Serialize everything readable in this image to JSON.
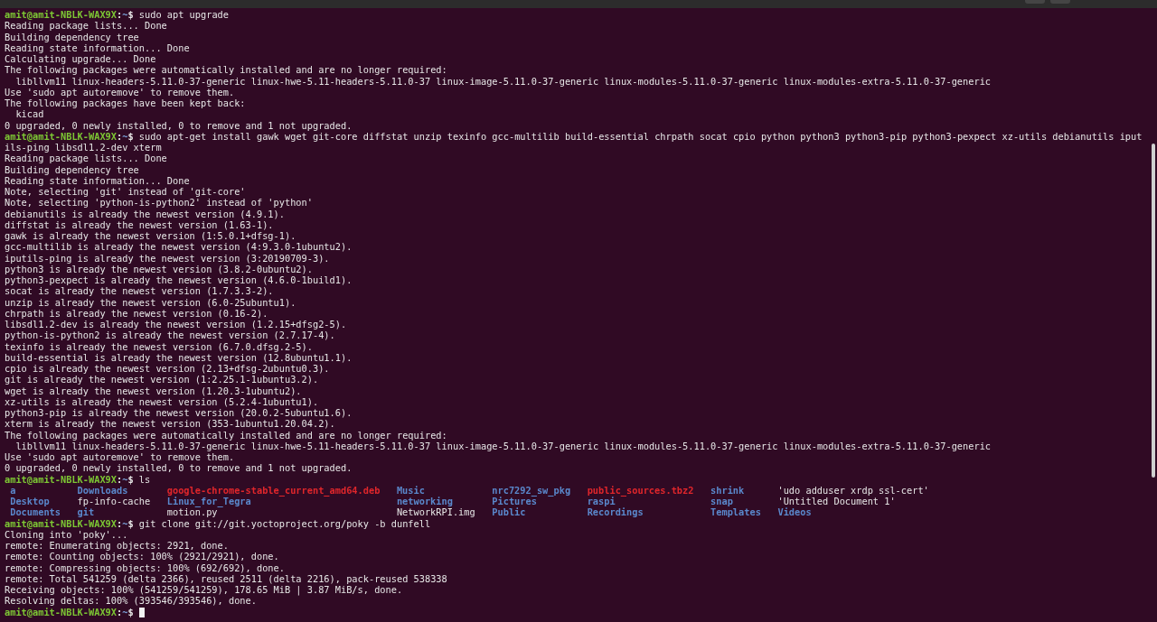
{
  "lines": [
    {
      "kind": "prompt",
      "user": "amit@amit-NBLK-WAX9X",
      "separator": ":",
      "path": "~",
      "symbol": "$",
      "command": "sudo apt upgrade"
    },
    {
      "kind": "output",
      "text": "Reading package lists... Done"
    },
    {
      "kind": "output",
      "text": "Building dependency tree"
    },
    {
      "kind": "output",
      "text": "Reading state information... Done"
    },
    {
      "kind": "output",
      "text": "Calculating upgrade... Done"
    },
    {
      "kind": "output",
      "text": "The following packages were automatically installed and are no longer required:"
    },
    {
      "kind": "output",
      "indent": true,
      "text": "libllvm11 linux-headers-5.11.0-37-generic linux-hwe-5.11-headers-5.11.0-37 linux-image-5.11.0-37-generic linux-modules-5.11.0-37-generic linux-modules-extra-5.11.0-37-generic"
    },
    {
      "kind": "output",
      "text": "Use 'sudo apt autoremove' to remove them."
    },
    {
      "kind": "output",
      "text": "The following packages have been kept back:"
    },
    {
      "kind": "output",
      "indent": true,
      "text": "kicad"
    },
    {
      "kind": "output",
      "text": "0 upgraded, 0 newly installed, 0 to remove and 1 not upgraded."
    },
    {
      "kind": "prompt",
      "user": "amit@amit-NBLK-WAX9X",
      "separator": ":",
      "path": "~",
      "symbol": "$",
      "command": "sudo apt-get install gawk wget git-core diffstat unzip texinfo gcc-multilib build-essential chrpath socat cpio python python3 python3-pip python3-pexpect xz-utils debianutils iput"
    },
    {
      "kind": "output",
      "text": "ils-ping libsdl1.2-dev xterm"
    },
    {
      "kind": "output",
      "text": "Reading package lists... Done"
    },
    {
      "kind": "output",
      "text": "Building dependency tree"
    },
    {
      "kind": "output",
      "text": "Reading state information... Done"
    },
    {
      "kind": "output",
      "text": "Note, selecting 'git' instead of 'git-core'"
    },
    {
      "kind": "output",
      "text": "Note, selecting 'python-is-python2' instead of 'python'"
    },
    {
      "kind": "output",
      "text": "debianutils is already the newest version (4.9.1)."
    },
    {
      "kind": "output",
      "text": "diffstat is already the newest version (1.63-1)."
    },
    {
      "kind": "output",
      "text": "gawk is already the newest version (1:5.0.1+dfsg-1)."
    },
    {
      "kind": "output",
      "text": "gcc-multilib is already the newest version (4:9.3.0-1ubuntu2)."
    },
    {
      "kind": "output",
      "text": "iputils-ping is already the newest version (3:20190709-3)."
    },
    {
      "kind": "output",
      "text": "python3 is already the newest version (3.8.2-0ubuntu2)."
    },
    {
      "kind": "output",
      "text": "python3-pexpect is already the newest version (4.6.0-1build1)."
    },
    {
      "kind": "output",
      "text": "socat is already the newest version (1.7.3.3-2)."
    },
    {
      "kind": "output",
      "text": "unzip is already the newest version (6.0-25ubuntu1)."
    },
    {
      "kind": "output",
      "text": "chrpath is already the newest version (0.16-2)."
    },
    {
      "kind": "output",
      "text": "libsdl1.2-dev is already the newest version (1.2.15+dfsg2-5)."
    },
    {
      "kind": "output",
      "text": "python-is-python2 is already the newest version (2.7.17-4)."
    },
    {
      "kind": "output",
      "text": "texinfo is already the newest version (6.7.0.dfsg.2-5)."
    },
    {
      "kind": "output",
      "text": "build-essential is already the newest version (12.8ubuntu1.1)."
    },
    {
      "kind": "output",
      "text": "cpio is already the newest version (2.13+dfsg-2ubuntu0.3)."
    },
    {
      "kind": "output",
      "text": "git is already the newest version (1:2.25.1-1ubuntu3.2)."
    },
    {
      "kind": "output",
      "text": "wget is already the newest version (1.20.3-1ubuntu2)."
    },
    {
      "kind": "output",
      "text": "xz-utils is already the newest version (5.2.4-1ubuntu1)."
    },
    {
      "kind": "output",
      "text": "python3-pip is already the newest version (20.0.2-5ubuntu1.6)."
    },
    {
      "kind": "output",
      "text": "xterm is already the newest version (353-1ubuntu1.20.04.2)."
    },
    {
      "kind": "output",
      "text": "The following packages were automatically installed and are no longer required:"
    },
    {
      "kind": "output",
      "indent": true,
      "text": "libllvm11 linux-headers-5.11.0-37-generic linux-hwe-5.11-headers-5.11.0-37 linux-image-5.11.0-37-generic linux-modules-5.11.0-37-generic linux-modules-extra-5.11.0-37-generic"
    },
    {
      "kind": "output",
      "text": "Use 'sudo apt autoremove' to remove them."
    },
    {
      "kind": "output",
      "text": "0 upgraded, 0 newly installed, 0 to remove and 1 not upgraded."
    },
    {
      "kind": "prompt",
      "user": "amit@amit-NBLK-WAX9X",
      "separator": ":",
      "path": "~",
      "symbol": "$",
      "command": "ls"
    },
    {
      "kind": "listing",
      "cells": [
        {
          "text": "a",
          "kind": "dir"
        },
        {
          "text": "Downloads",
          "kind": "dir"
        },
        {
          "text": "google-chrome-stable_current_amd64.deb",
          "kind": "archive"
        },
        {
          "text": "Music",
          "kind": "dir"
        },
        {
          "text": "nrc7292_sw_pkg",
          "kind": "dir"
        },
        {
          "text": "public_sources.tbz2",
          "kind": "archive"
        },
        {
          "text": "shrink",
          "kind": "dir"
        },
        {
          "text": "'udo adduser xrdp ssl-cert'",
          "kind": "file"
        }
      ]
    },
    {
      "kind": "listing",
      "cells": [
        {
          "text": "Desktop",
          "kind": "dir"
        },
        {
          "text": "fp-info-cache",
          "kind": "file"
        },
        {
          "text": "Linux_for_Tegra",
          "kind": "dir"
        },
        {
          "text": "networking",
          "kind": "dir"
        },
        {
          "text": "Pictures",
          "kind": "dir"
        },
        {
          "text": "raspi",
          "kind": "dir"
        },
        {
          "text": "snap",
          "kind": "dir"
        },
        {
          "text": "'Untitled Document 1'",
          "kind": "file"
        }
      ]
    },
    {
      "kind": "listing",
      "cells": [
        {
          "text": "Documents",
          "kind": "dir"
        },
        {
          "text": "git",
          "kind": "dir"
        },
        {
          "text": "motion.py",
          "kind": "file"
        },
        {
          "text": "NetworkRPI.img",
          "kind": "file"
        },
        {
          "text": "Public",
          "kind": "dir"
        },
        {
          "text": "Recordings",
          "kind": "dir"
        },
        {
          "text": "Templates",
          "kind": "dir"
        },
        {
          "text": "Videos",
          "kind": "dir"
        }
      ]
    },
    {
      "kind": "prompt",
      "user": "amit@amit-NBLK-WAX9X",
      "separator": ":",
      "path": "~",
      "symbol": "$",
      "command": "git clone git://git.yoctoproject.org/poky -b dunfell"
    },
    {
      "kind": "output",
      "text": "Cloning into 'poky'..."
    },
    {
      "kind": "output",
      "text": "remote: Enumerating objects: 2921, done."
    },
    {
      "kind": "output",
      "text": "remote: Counting objects: 100% (2921/2921), done."
    },
    {
      "kind": "output",
      "text": "remote: Compressing objects: 100% (692/692), done."
    },
    {
      "kind": "output",
      "text": "remote: Total 541259 (delta 2366), reused 2511 (delta 2216), pack-reused 538338"
    },
    {
      "kind": "output",
      "text": "Receiving objects: 100% (541259/541259), 178.65 MiB | 3.87 MiB/s, done."
    },
    {
      "kind": "output",
      "text": "Resolving deltas: 100% (393546/393546), done."
    },
    {
      "kind": "prompt",
      "user": "amit@amit-NBLK-WAX9X",
      "separator": ":",
      "path": "~",
      "symbol": "$",
      "cursor": true
    }
  ]
}
